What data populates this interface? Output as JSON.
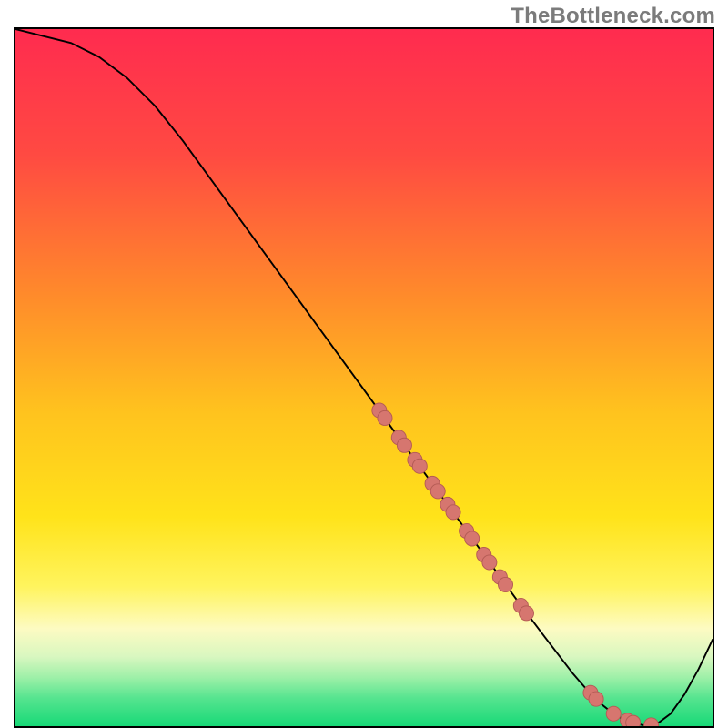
{
  "watermark": "TheBottleneck.com",
  "colors": {
    "curve": "#000000",
    "point_fill": "#d6766f",
    "point_stroke": "#b35a54"
  },
  "chart_data": {
    "type": "line",
    "title": "",
    "xlabel": "",
    "ylabel": "",
    "xlim": [
      0,
      100
    ],
    "ylim": [
      0,
      100
    ],
    "grid": false,
    "legend": false,
    "series": [
      {
        "name": "bottleneck-curve",
        "x": [
          0,
          4,
          8,
          12,
          16,
          20,
          24,
          28,
          32,
          36,
          40,
          44,
          48,
          52,
          56,
          60,
          64,
          68,
          72,
          76,
          80,
          82,
          84,
          86,
          88,
          90,
          92,
          94,
          96,
          98,
          100
        ],
        "y": [
          100,
          99,
          98,
          96,
          93,
          89,
          84,
          78.5,
          73,
          67.5,
          62,
          56.5,
          51,
          45.5,
          40,
          34.5,
          29,
          23.5,
          18,
          12.7,
          7.5,
          5.2,
          3.2,
          1.6,
          0.6,
          0.15,
          0.3,
          1.8,
          4.6,
          8.2,
          12.4
        ]
      }
    ],
    "scatter_points": {
      "name": "highlighted-points",
      "x": [
        52.2,
        53.0,
        55.0,
        55.8,
        57.3,
        58.0,
        59.8,
        60.6,
        62.0,
        62.8,
        64.7,
        65.5,
        67.2,
        68.0,
        69.5,
        70.3,
        72.5,
        73.3,
        82.5,
        83.3,
        85.8,
        87.8,
        88.6,
        91.2
      ],
      "y": [
        45.3,
        44.2,
        41.4,
        40.3,
        38.2,
        37.3,
        34.8,
        33.7,
        31.8,
        30.7,
        28.0,
        26.9,
        24.6,
        23.5,
        21.4,
        20.3,
        17.3,
        16.2,
        4.8,
        3.9,
        1.8,
        0.8,
        0.5,
        0.15
      ]
    }
  }
}
